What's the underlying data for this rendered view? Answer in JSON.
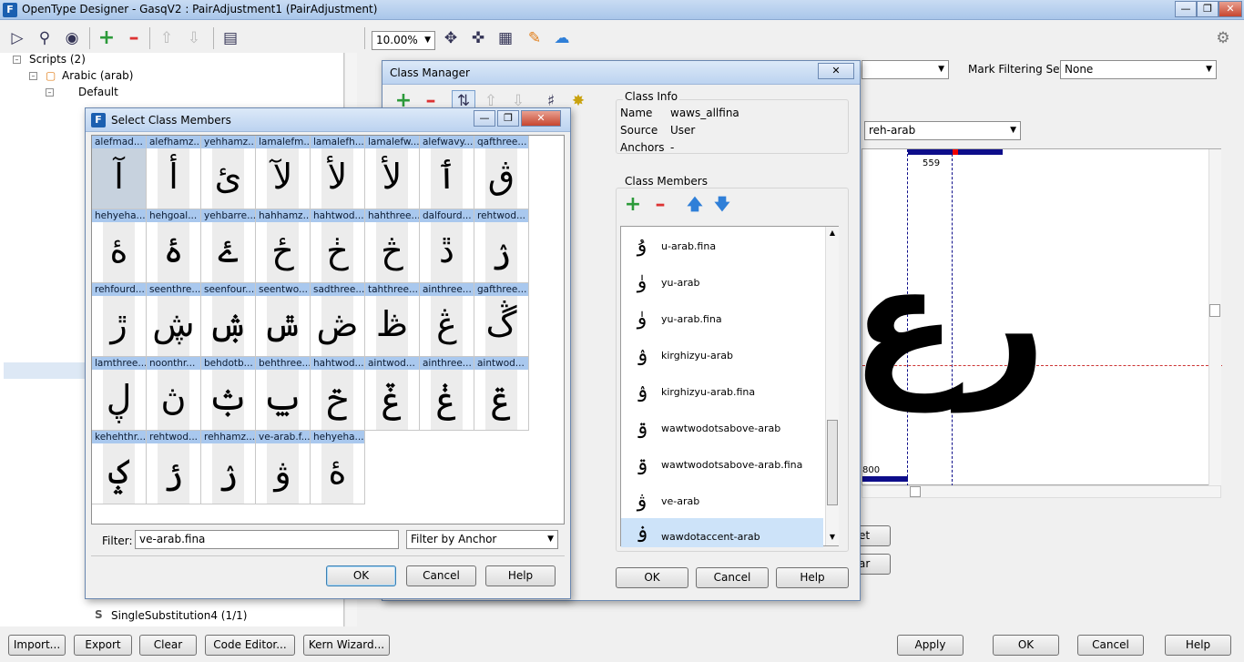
{
  "app": {
    "title": "OpenType Designer - GasqV2 : PairAdjustment1 (PairAdjustment)"
  },
  "toolbar": {
    "zoom": "10.00%"
  },
  "tree": {
    "items": [
      {
        "label": "Scripts (2)"
      },
      {
        "label": "Arabic (arab)"
      },
      {
        "label": "Default"
      },
      {
        "label": "SingleSubstitution4 (1/1)"
      }
    ]
  },
  "right": {
    "mark_filter_label": "Mark Filtering Set:",
    "mark_filter_value": "None",
    "glyph_select": "reh-arab",
    "canvas_top_value": "559",
    "canvas_bottom_value": "800",
    "btn_a": "et",
    "btn_b": "ar"
  },
  "class_manager": {
    "title": "Class Manager",
    "info_heading": "Class Info",
    "name_label": "Name",
    "name_value": "waws_allfina",
    "source_label": "Source",
    "source_value": "User",
    "anchors_label": "Anchors",
    "anchors_value": "-",
    "members_heading": "Class Members",
    "members": [
      {
        "glyph": "ۇ",
        "name": "u-arab.fina"
      },
      {
        "glyph": "ۈ",
        "name": "yu-arab"
      },
      {
        "glyph": "ۈ",
        "name": "yu-arab.fina"
      },
      {
        "glyph": "ۉ",
        "name": "kirghizyu-arab"
      },
      {
        "glyph": "ۉ",
        "name": "kirghizyu-arab.fina"
      },
      {
        "glyph": "ۊ",
        "name": "wawtwodotsabove-arab"
      },
      {
        "glyph": "ۊ",
        "name": "wawtwodotsabove-arab.fina"
      },
      {
        "glyph": "ۋ",
        "name": "ve-arab"
      },
      {
        "glyph": "ۏ",
        "name": "wawdotaccent-arab"
      }
    ],
    "ok": "OK",
    "cancel": "Cancel",
    "help": "Help"
  },
  "select_dialog": {
    "title": "Select Class Members",
    "cells": [
      {
        "label": "alefmad...",
        "glyph": "آ"
      },
      {
        "label": "alefhamz...",
        "glyph": "أ"
      },
      {
        "label": "yehhamz...",
        "glyph": "ئ"
      },
      {
        "label": "lamalefm...",
        "glyph": "لآ"
      },
      {
        "label": "lamalefh...",
        "glyph": "لأ"
      },
      {
        "label": "lamalefw...",
        "glyph": "لأ"
      },
      {
        "label": "alefwavy...",
        "glyph": "ٲ"
      },
      {
        "label": "qafthree...",
        "glyph": "ڨ"
      },
      {
        "label": "hehyeha...",
        "glyph": "ۀ"
      },
      {
        "label": "hehgoal...",
        "glyph": "ۂ"
      },
      {
        "label": "yehbarre...",
        "glyph": "ۓ"
      },
      {
        "label": "hahhamz...",
        "glyph": "ځ"
      },
      {
        "label": "hahtwod...",
        "glyph": "ڂ"
      },
      {
        "label": "hahthree...",
        "glyph": "څ"
      },
      {
        "label": "dalfourd...",
        "glyph": "ڐ"
      },
      {
        "label": "rehtwod...",
        "glyph": "ۯ"
      },
      {
        "label": "rehfourd...",
        "glyph": "ڙ"
      },
      {
        "label": "seenthre...",
        "glyph": "ڜ"
      },
      {
        "label": "seenfour...",
        "glyph": "ۺ"
      },
      {
        "label": "seentwo...",
        "glyph": "ݜ"
      },
      {
        "label": "sadthree...",
        "glyph": "ڞ"
      },
      {
        "label": "tahthree...",
        "glyph": "ڟ"
      },
      {
        "label": "ainthree...",
        "glyph": "ڠ"
      },
      {
        "label": "gafthree...",
        "glyph": "ڴ"
      },
      {
        "label": "lamthree...",
        "glyph": "ڸ"
      },
      {
        "label": "noonthr...",
        "glyph": "ڽ"
      },
      {
        "label": "behdotb...",
        "glyph": "ݑ"
      },
      {
        "label": "behthree...",
        "glyph": "ݐ"
      },
      {
        "label": "hahtwod...",
        "glyph": "ݗ"
      },
      {
        "label": "aintwod...",
        "glyph": "ݞ"
      },
      {
        "label": "ainthree...",
        "glyph": "ݟ"
      },
      {
        "label": "aintwod...",
        "glyph": "ݝ"
      },
      {
        "label": "kehehthr...",
        "glyph": "ݤ"
      },
      {
        "label": "rehtwod...",
        "glyph": "ݬ"
      },
      {
        "label": "rehhamz...",
        "glyph": "ۯ"
      },
      {
        "label": "ve-arab.f...",
        "glyph": "ۋ"
      },
      {
        "label": "hehyeha...",
        "glyph": "ۀ"
      }
    ],
    "filter_label": "Filter:",
    "filter_value": "ve-arab.fina",
    "filter_mode": "Filter by Anchor",
    "ok": "OK",
    "cancel": "Cancel",
    "help": "Help"
  },
  "bottom": {
    "import": "Import...",
    "export": "Export",
    "clear": "Clear",
    "code_editor": "Code Editor...",
    "kern_wizard": "Kern Wizard...",
    "apply": "Apply",
    "ok": "OK",
    "cancel": "Cancel",
    "help": "Help"
  }
}
